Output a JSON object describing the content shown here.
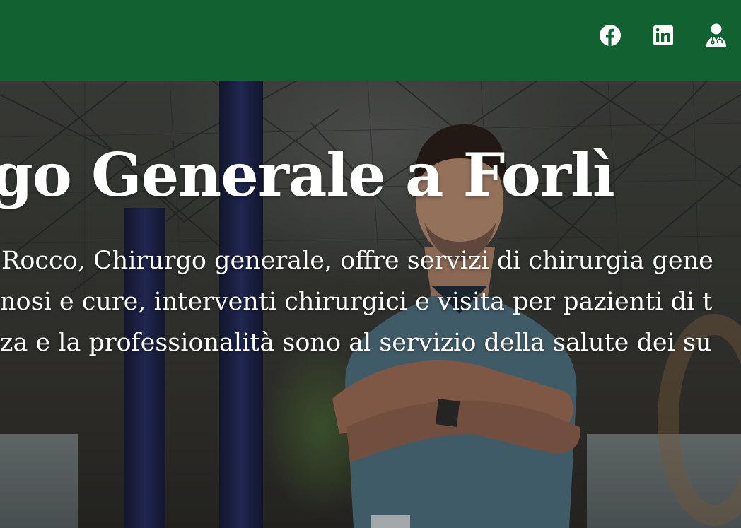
{
  "header": {
    "background_color": "#126130",
    "social_links": [
      {
        "name": "facebook",
        "icon": "facebook-icon"
      },
      {
        "name": "linkedin",
        "icon": "linkedin-icon"
      },
      {
        "name": "doctor-profile",
        "icon": "doctor-icon"
      }
    ]
  },
  "hero": {
    "title": "go Generale a Forlì",
    "lines": [
      "Rocco, Chirurgo generale, offre servizi di chirurgia gene",
      "nosi e cure, interventi chirurgici e visita per pazienti di t",
      "za e la professionalità sono al servizio della salute dei su"
    ],
    "text_color": "#ffffff"
  }
}
